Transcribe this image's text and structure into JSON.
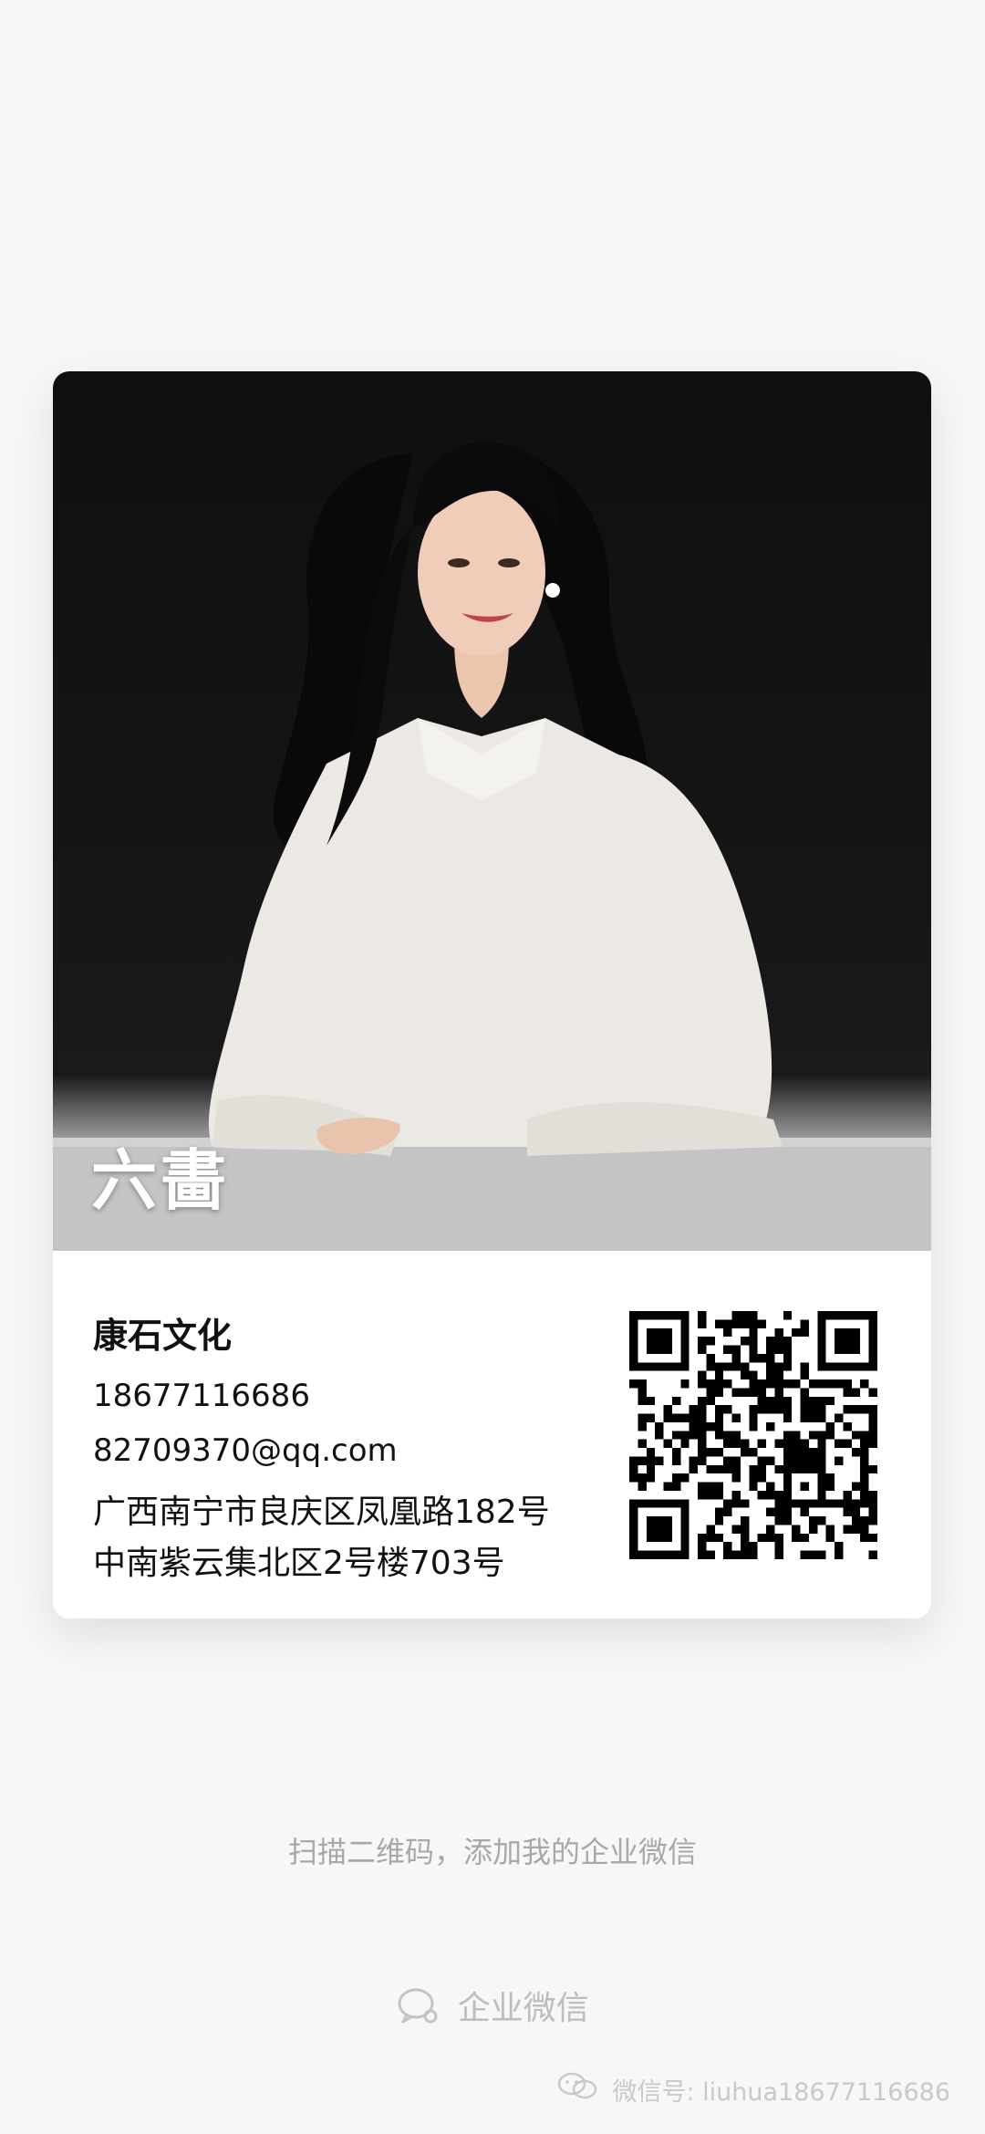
{
  "card": {
    "name": "六畵",
    "company": "康石文化",
    "phone": "18677116686",
    "email": "82709370@qq.com",
    "address_line1": "广西南宁市良庆区凤凰路182号",
    "address_line2": "中南紫云集北区2号楼703号"
  },
  "hint": "扫描二维码，添加我的企业微信",
  "brand": {
    "label": "企业微信",
    "icon": "wecom-logo-icon"
  },
  "watermark": {
    "text": "微信号: liuhua18677116686",
    "icon": "wechat-icon"
  },
  "colors": {
    "background": "#f7f7f8",
    "card": "#ffffff",
    "hint_text": "#a8a8aa",
    "photo_bg": "#121213"
  }
}
